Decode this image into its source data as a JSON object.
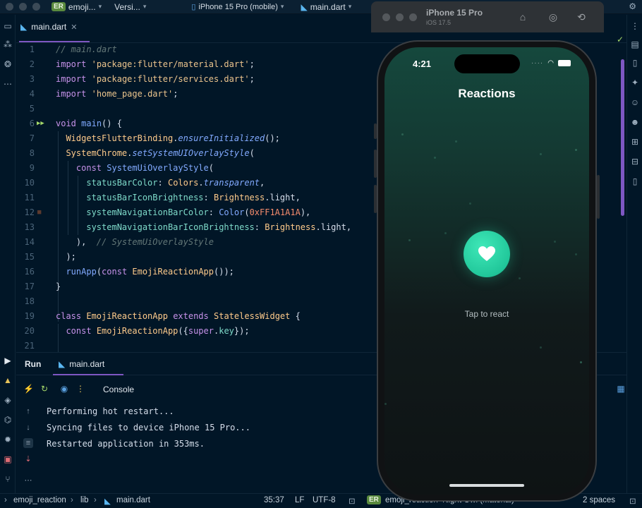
{
  "titlebar": {
    "project_badge": "ER",
    "project_name": "emoji...",
    "vcs_label": "Versi...",
    "device": "iPhone 15 Pro (mobile)",
    "run_config": "main.dart"
  },
  "simulator": {
    "title": "iPhone 15 Pro",
    "subtitle": "iOS 17.5"
  },
  "editor": {
    "tab_label": "main.dart",
    "lines": [
      1,
      2,
      3,
      4,
      5,
      6,
      7,
      8,
      9,
      10,
      11,
      12,
      13,
      14,
      15,
      16,
      17,
      18,
      19,
      20,
      21
    ]
  },
  "phone": {
    "time": "4:21",
    "app_title": "Reactions",
    "hint": "Tap to react"
  },
  "run_panel": {
    "title": "Run",
    "tab_label": "main.dart",
    "console_label": "Console",
    "output": [
      "Performing hot restart...",
      "Syncing files to device iPhone 15 Pro...",
      "Restarted application in 353ms."
    ]
  },
  "statusbar": {
    "project": "emoji_reaction",
    "folder": "lib",
    "file": "main.dart",
    "position": "35:37",
    "line_sep": "LF",
    "encoding": "UTF-8",
    "badge": "ER",
    "theme_label": "emoji_reaction  Night Owl (Material)",
    "indent": "2 spaces"
  },
  "colors": {
    "background": "#011627",
    "accent": "#7e57c2",
    "heart_button": "#21c79a"
  }
}
